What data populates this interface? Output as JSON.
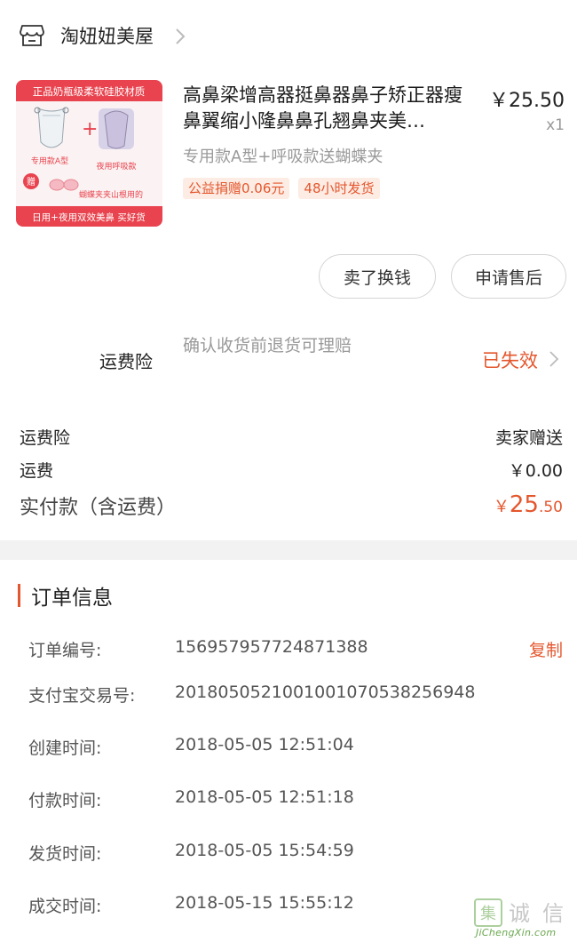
{
  "shop": {
    "name": "淘妞妞美屋",
    "icon": "store-icon"
  },
  "product": {
    "thumbnail": {
      "banner_top": "正品奶瓶级柔软硅胶材质",
      "label_left": "专用款A型",
      "label_right": "夜用呼吸款",
      "gift_badge": "赠",
      "gift_caption": "蝴蝶夹夹山根用的",
      "banner_bottom": "日用+夜用双效美鼻 买好货"
    },
    "title": "高鼻梁增高器挺鼻器鼻子矫正器瘦鼻翼缩小隆鼻鼻孔翘鼻夹美…",
    "price": "￥25.50",
    "quantity": "x1",
    "spec": "专用款A型+呼吸款送蝴蝶夹",
    "tags": [
      "公益捐赠0.06元",
      "48小时发货"
    ]
  },
  "actions": {
    "sell_label": "卖了换钱",
    "aftersale_label": "申请售后"
  },
  "insurance": {
    "label": "运费险",
    "description": "确认收货前退货可理赔",
    "status": "已失效"
  },
  "fees": {
    "insurance_label": "运费险",
    "insurance_value": "卖家赠送",
    "shipping_label": "运费",
    "shipping_value": "￥0.00",
    "paid_label": "实付款（含运费）",
    "paid_symbol": "￥",
    "paid_int": "25",
    "paid_dec": ".50"
  },
  "order_info": {
    "title": "订单信息",
    "copy_label": "复制",
    "rows": [
      {
        "key": "订单编号:",
        "value": "156957957724871388"
      },
      {
        "key": "支付宝交易号:",
        "value": "2018050521001001070538256948"
      },
      {
        "key": "创建时间:",
        "value": "2018-05-05 12:51:04"
      },
      {
        "key": "付款时间:",
        "value": "2018-05-05 12:51:18"
      },
      {
        "key": "发货时间:",
        "value": "2018-05-05 15:54:59"
      },
      {
        "key": "成交时间:",
        "value": "2018-05-15 15:55:12"
      }
    ]
  },
  "watermark": {
    "text": "JiChengXin.com",
    "glyphs": "集诚信"
  },
  "colors": {
    "accent": "#e4572e",
    "muted": "#999999",
    "divider": "#f2f2f2"
  }
}
